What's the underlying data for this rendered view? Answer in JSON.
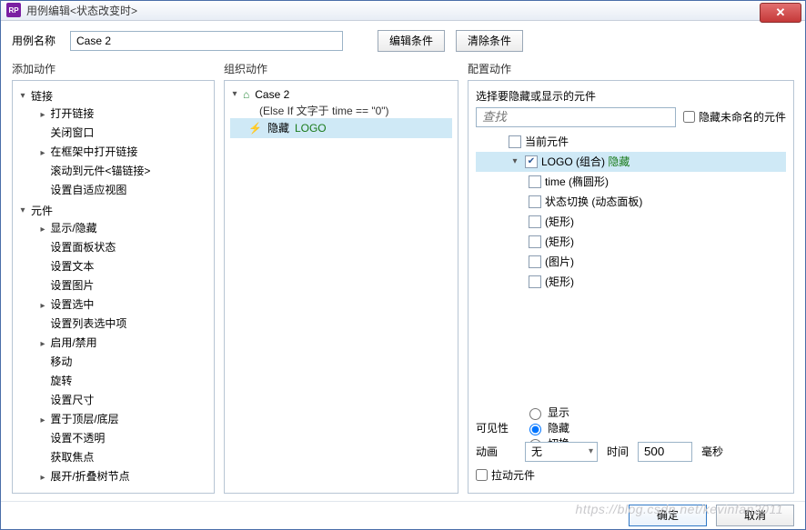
{
  "window": {
    "title": "用例编辑<状态改变时>",
    "app_icon_text": "RP"
  },
  "buttons": {
    "close": "✕",
    "edit_cond": "编辑条件",
    "clear_cond": "清除条件",
    "ok": "确定",
    "cancel": "取消"
  },
  "name_row": {
    "label": "用例名称",
    "value": "Case 2"
  },
  "section_labels": {
    "add": "添加动作",
    "org": "组织动作",
    "cfg": "配置动作"
  },
  "add_actions": {
    "groups": [
      {
        "label": "链接",
        "children": [
          {
            "label": "打开链接",
            "expandable": true
          },
          {
            "label": "关闭窗口"
          },
          {
            "label": "在框架中打开链接",
            "expandable": true
          },
          {
            "label": "滚动到元件<锚链接>"
          },
          {
            "label": "设置自适应视图"
          }
        ]
      },
      {
        "label": "元件",
        "children": [
          {
            "label": "显示/隐藏",
            "expandable": true
          },
          {
            "label": "设置面板状态"
          },
          {
            "label": "设置文本"
          },
          {
            "label": "设置图片"
          },
          {
            "label": "设置选中",
            "expandable": true
          },
          {
            "label": "设置列表选中项"
          },
          {
            "label": "启用/禁用",
            "expandable": true
          },
          {
            "label": "移动"
          },
          {
            "label": "旋转"
          },
          {
            "label": "设置尺寸"
          },
          {
            "label": "置于顶层/底层",
            "expandable": true
          },
          {
            "label": "设置不透明"
          },
          {
            "label": "获取焦点"
          },
          {
            "label": "展开/折叠树节点",
            "expandable": true
          }
        ]
      }
    ]
  },
  "org": {
    "case_name": "Case 2",
    "condition": "(Else If 文字于 time == \"0\")",
    "action_prefix": "隐藏",
    "action_target": "LOGO"
  },
  "cfg": {
    "subhead": "选择要隐藏或显示的元件",
    "search_placeholder": "查找",
    "hide_unnamed_label": "隐藏未命名的元件",
    "elements": [
      {
        "indent": "child",
        "checked": false,
        "label": "当前元件"
      },
      {
        "indent": "child",
        "checked": true,
        "selected": true,
        "expand": true,
        "label": "LOGO (组合)",
        "tag": "隐藏"
      },
      {
        "indent": "grandchild",
        "checked": false,
        "label": "time (椭圆形)"
      },
      {
        "indent": "grandchild",
        "checked": false,
        "label": "状态切换 (动态面板)"
      },
      {
        "indent": "grandchild",
        "checked": false,
        "label": "(矩形)"
      },
      {
        "indent": "grandchild",
        "checked": false,
        "label": "(矩形)"
      },
      {
        "indent": "grandchild",
        "checked": false,
        "label": "(图片)"
      },
      {
        "indent": "grandchild",
        "checked": false,
        "label": "(矩形)"
      }
    ],
    "visibility": {
      "label": "可见性",
      "options": [
        "显示",
        "隐藏",
        "切换"
      ],
      "selected": 1
    },
    "anim": {
      "label": "动画",
      "value": "无",
      "time_label": "时间",
      "time_value": "500",
      "time_unit": "毫秒"
    },
    "pull_label": "拉动元件"
  },
  "watermark": "https://blog.csdn.net/kevinfan2011"
}
